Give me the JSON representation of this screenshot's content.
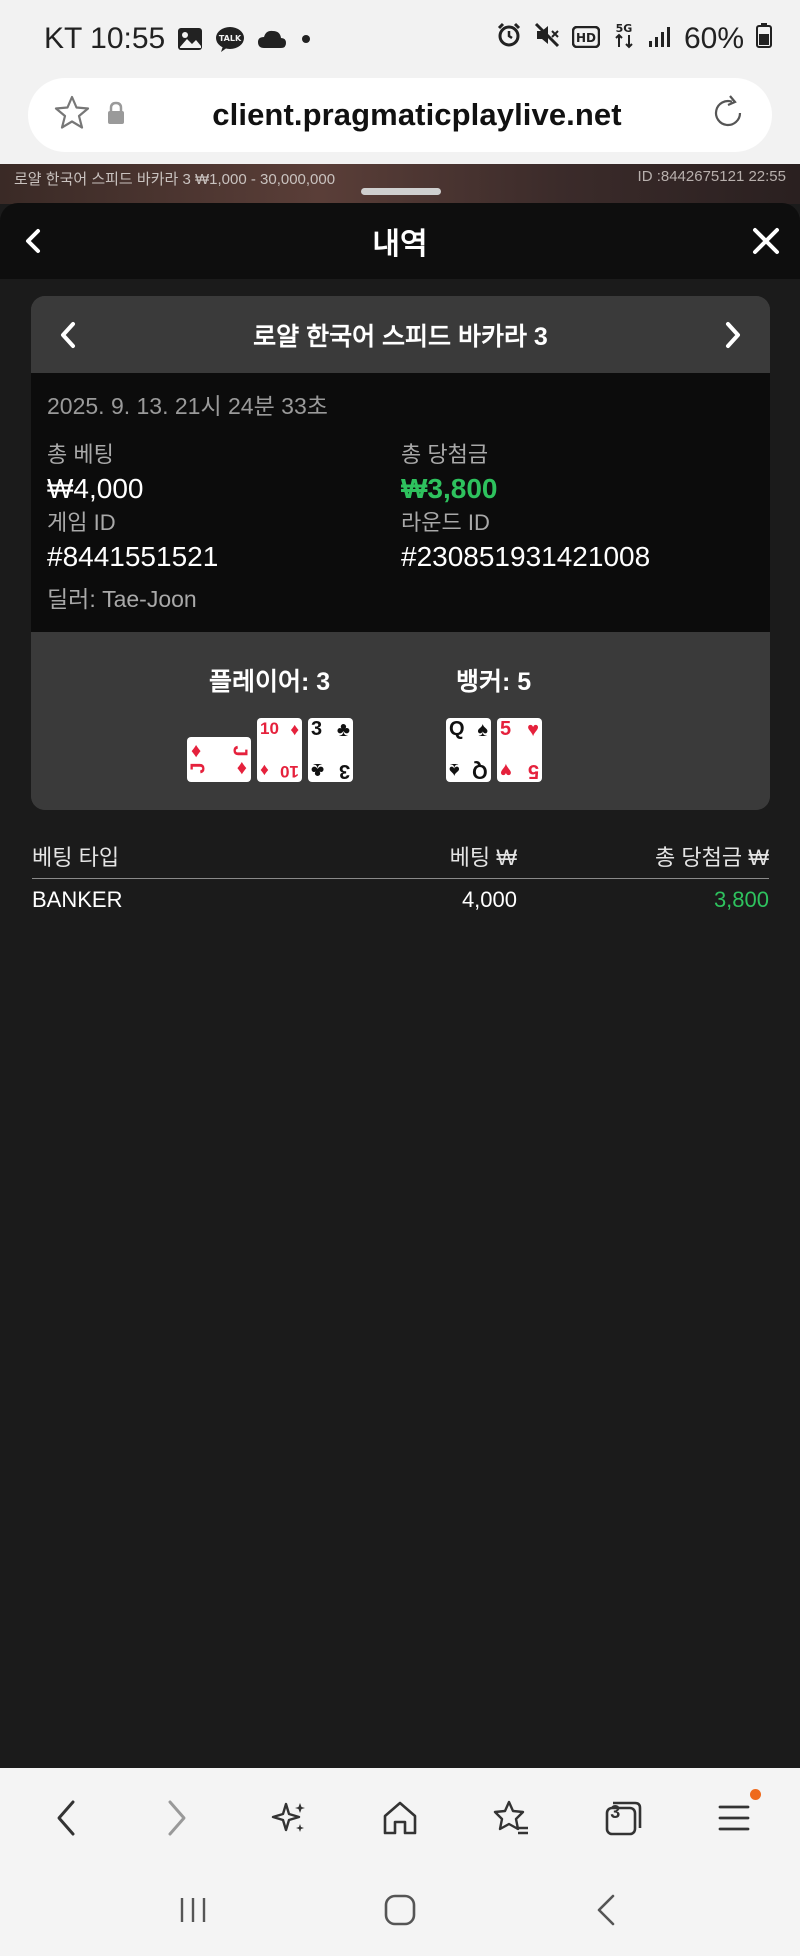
{
  "status_bar": {
    "carrier_time": "KT 10:55",
    "battery": "60%"
  },
  "browser": {
    "url": "client.pragmaticplaylive.net",
    "tab_count": "3"
  },
  "video_strip": {
    "left_text": "로얄 한국어 스피드 바카라 3 ₩1,000 - 30,000,000",
    "right_text": "ID :8442675121 22:55"
  },
  "sheet": {
    "title": "내역"
  },
  "game_card": {
    "title": "로얄 한국어 스피드 바카라 3",
    "datetime": "2025. 9. 13. 21시 24분 33초",
    "total_bet_label": "총 베팅",
    "total_bet_value": "₩4,000",
    "total_win_label": "총 당첨금",
    "total_win_value": "₩3,800",
    "game_id_label": "게임 ID",
    "game_id_value": "#8441551521",
    "round_id_label": "라운드 ID",
    "round_id_value": "#230851931421008",
    "dealer": "딜러: Tae-Joon",
    "player_label": "플레이어: 3",
    "banker_label": "뱅커: 5",
    "player_cards": [
      {
        "rank": "J",
        "suit": "♦",
        "color": "#e5213c"
      },
      {
        "rank": "10",
        "suit": "♦",
        "color": "#e5213c"
      },
      {
        "rank": "3",
        "suit": "♣",
        "color": "#111111"
      }
    ],
    "banker_cards": [
      {
        "rank": "Q",
        "suit": "♠",
        "color": "#111111"
      },
      {
        "rank": "5",
        "suit": "♥",
        "color": "#e5213c"
      }
    ]
  },
  "bet_table": {
    "headers": [
      "베팅 타입",
      "베팅 ₩",
      "총 당첨금 ₩"
    ],
    "rows": [
      {
        "type": "BANKER",
        "bet": "4,000",
        "win": "3,800"
      }
    ]
  },
  "colors": {
    "win_green": "#2ec25e",
    "card_red": "#e5213c",
    "notification_dot": "#ef6a1c"
  }
}
